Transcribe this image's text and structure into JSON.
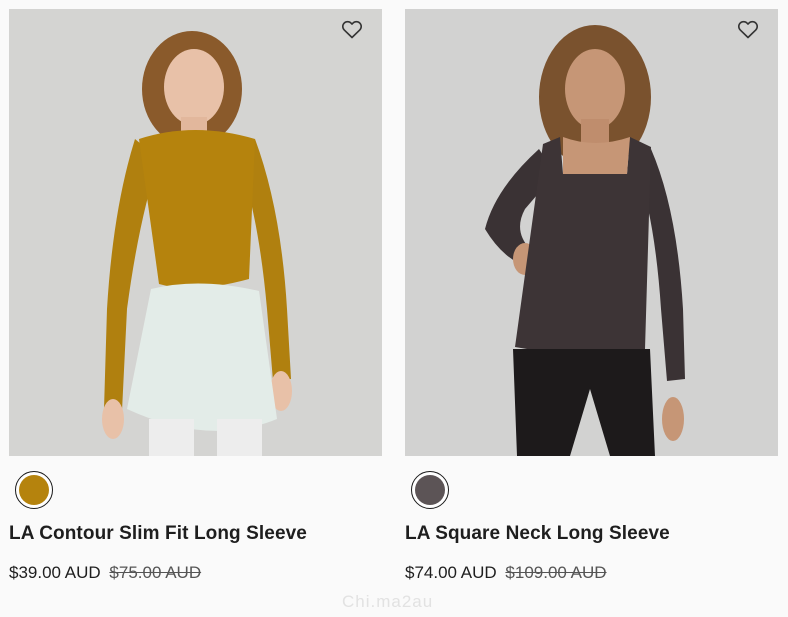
{
  "products": [
    {
      "name": "LA Contour Slim Fit Long Sleeve",
      "price": "$39.00 AUD",
      "was_price": "$75.00 AUD",
      "swatch_color": "#b5830d",
      "wishlist_icon": "heart-outline-icon"
    },
    {
      "name": "LA Square Neck Long Sleeve",
      "price": "$74.00 AUD",
      "was_price": "$109.00 AUD",
      "swatch_color": "#5c5456",
      "wishlist_icon": "heart-outline-icon"
    }
  ],
  "watermark": "Chi.ma2au"
}
